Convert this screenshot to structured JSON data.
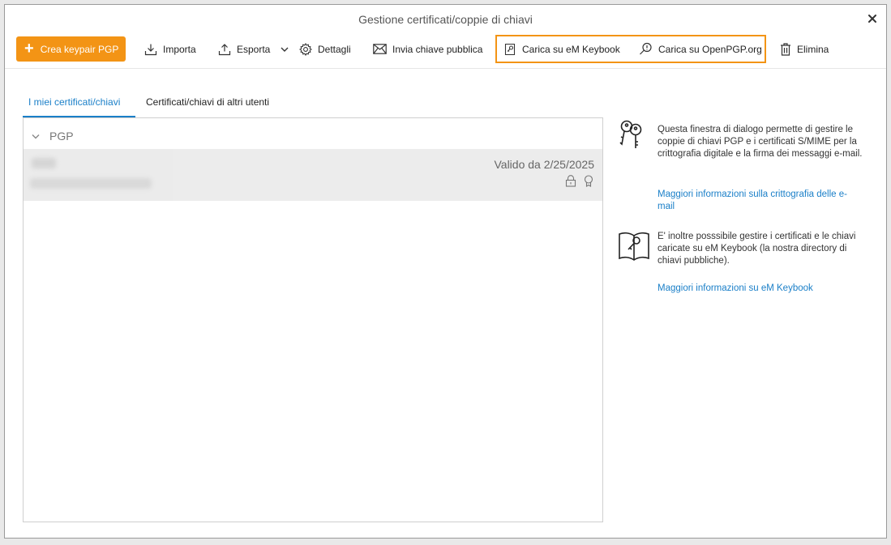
{
  "window": {
    "title": "Gestione certificati/coppie di chiavi",
    "close_icon": "close-icon"
  },
  "toolbar": {
    "create_label": "Crea keypair PGP",
    "import_label": "Importa",
    "export_label": "Esporta",
    "details_label": "Dettagli",
    "send_public_label": "Invia chiave pubblica",
    "upload_keybook_label": "Carica su eM Keybook",
    "upload_openpgp_label": "Carica su OpenPGP.org",
    "delete_label": "Elimina"
  },
  "tabs": [
    {
      "label": "I miei certificati/chiavi",
      "active": true
    },
    {
      "label": "Certificati/chiavi di altri utenti",
      "active": false
    }
  ],
  "list": {
    "group_label": "PGP",
    "rows": [
      {
        "valid_from": "Valido da 2/25/2025"
      }
    ]
  },
  "info": {
    "block1_text": "Questa finestra di dialogo permette di gestire le coppie di chiavi PGP e i certificati S/MIME per la crittografia digitale e la firma dei messaggi e-mail.",
    "block1_link": "Maggiori informazioni sulla crittografia delle e-mail",
    "block2_text": "E' inoltre posssibile gestire i certificati e le chiavi caricate su eM Keybook (la nostra directory di chiavi pubbliche).",
    "block2_link": "Maggiori informazioni su eM Keybook"
  },
  "colors": {
    "accent": "#f39415",
    "link": "#1a7fc8",
    "row_selected": "#ececec"
  }
}
